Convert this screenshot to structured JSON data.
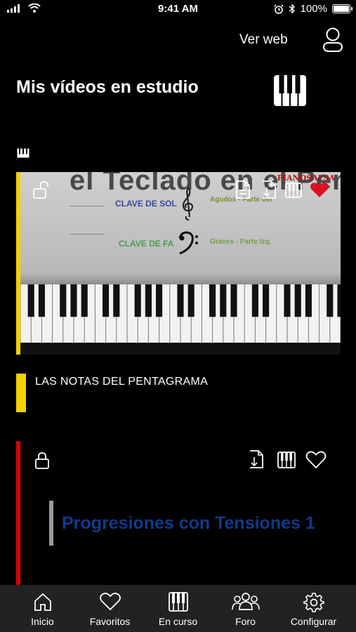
{
  "status": {
    "time": "9:41 AM",
    "battery": "100%",
    "battery_level": 1.0
  },
  "header": {
    "ver_web": "Ver web",
    "title": "Mis vídeos en estudio"
  },
  "video_card": {
    "thumbnail_heading": "el Teclado en el Pen",
    "brand": "PIANOSALSA",
    "clave_sol": "CLAVE DE SOL",
    "clave_fa": "CLAVE DE FA",
    "agudos": "Agudos - Parte der",
    "graves": "Graves - Parte Izq.",
    "title": "LAS NOTAS DEL PENTAGRAMA",
    "accent_color": "#f4d000",
    "favorited": true
  },
  "second_card": {
    "title": "Progresiones con Tensiones 1",
    "accent_color": "#e00000",
    "favorited": false
  },
  "tabs": [
    {
      "label": "Inicio",
      "icon": "home-icon"
    },
    {
      "label": "Favoritos",
      "icon": "heart-icon"
    },
    {
      "label": "En curso",
      "icon": "piano-icon"
    },
    {
      "label": "Foro",
      "icon": "group-icon"
    },
    {
      "label": "Configurar",
      "icon": "gear-icon"
    }
  ],
  "colors": {
    "background": "#000000",
    "tab_bar": "#222222",
    "heart_active": "#e0101e"
  }
}
